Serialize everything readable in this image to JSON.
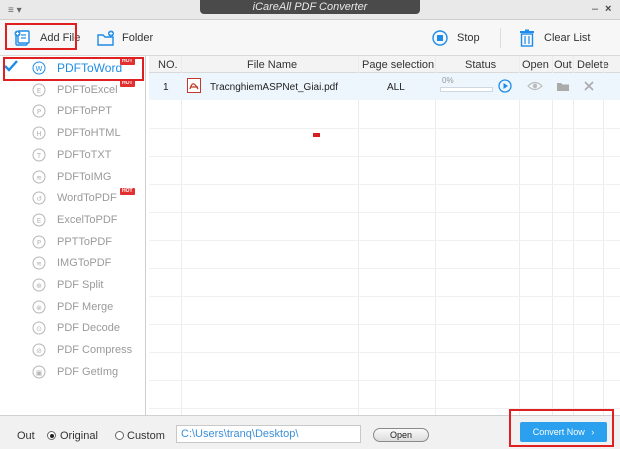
{
  "titlebar": {
    "menu_glyph": "≡ ▾",
    "title": "iCareAll PDF Converter",
    "minimize": "–",
    "close": "×"
  },
  "toolbar": {
    "add_file_label": "Add File",
    "folder_label": "Folder",
    "stop_label": "Stop",
    "clear_list_label": "Clear List",
    "accent_color": "#1e8ce8"
  },
  "sidebar": {
    "items": [
      {
        "label": "PDFToWord",
        "icon": "word-icon",
        "glyph": "W",
        "active": true,
        "hot": true
      },
      {
        "label": "PDFToExcel",
        "icon": "excel-icon",
        "glyph": "E",
        "active": false,
        "hot": true
      },
      {
        "label": "PDFToPPT",
        "icon": "ppt-icon",
        "glyph": "P",
        "active": false,
        "hot": false
      },
      {
        "label": "PDFToHTML",
        "icon": "html-icon",
        "glyph": "H",
        "active": false,
        "hot": false
      },
      {
        "label": "PDFToTXT",
        "icon": "txt-icon",
        "glyph": "T",
        "active": false,
        "hot": false
      },
      {
        "label": "PDFToIMG",
        "icon": "img-icon",
        "glyph": "≋",
        "active": false,
        "hot": false
      },
      {
        "label": "WordToPDF",
        "icon": "word-to-pdf-icon",
        "glyph": "↺",
        "active": false,
        "hot": true
      },
      {
        "label": "ExcelToPDF",
        "icon": "excel-to-pdf-icon",
        "glyph": "E",
        "active": false,
        "hot": false
      },
      {
        "label": "PPTToPDF",
        "icon": "ppt-to-pdf-icon",
        "glyph": "P",
        "active": false,
        "hot": false
      },
      {
        "label": "IMGToPDF",
        "icon": "img-to-pdf-icon",
        "glyph": "≋",
        "active": false,
        "hot": false
      },
      {
        "label": "PDF Split",
        "icon": "split-icon",
        "glyph": "⊕",
        "active": false,
        "hot": false
      },
      {
        "label": "PDF Merge",
        "icon": "merge-icon",
        "glyph": "⊗",
        "active": false,
        "hot": false
      },
      {
        "label": "PDF Decode",
        "icon": "decode-icon",
        "glyph": "⊙",
        "active": false,
        "hot": false
      },
      {
        "label": "PDF Compress",
        "icon": "compress-icon",
        "glyph": "⊘",
        "active": false,
        "hot": false
      },
      {
        "label": "PDF GetImg",
        "icon": "getimg-icon",
        "glyph": "▣",
        "active": false,
        "hot": false
      }
    ],
    "hot_badge": "HOT"
  },
  "table": {
    "headers": {
      "no": "NO.",
      "file_name": "File Name",
      "page_selection": "Page selection",
      "status": "Status",
      "open": "Open",
      "out": "Out",
      "delete": "Delete"
    },
    "rows": [
      {
        "no": "1",
        "file_name": "TracnghiemASPNet_Giai.pdf",
        "page_selection": "ALL",
        "progress_text": "0%",
        "progress": 0
      }
    ]
  },
  "footer": {
    "out_label": "Out",
    "original_label": "Original",
    "custom_label": "Custom",
    "selected_option": "Original",
    "path_value": "C:\\Users\\tranq\\Desktop\\",
    "open_button": "Open",
    "convert_button": "Convert Now",
    "convert_arrow": "›"
  }
}
